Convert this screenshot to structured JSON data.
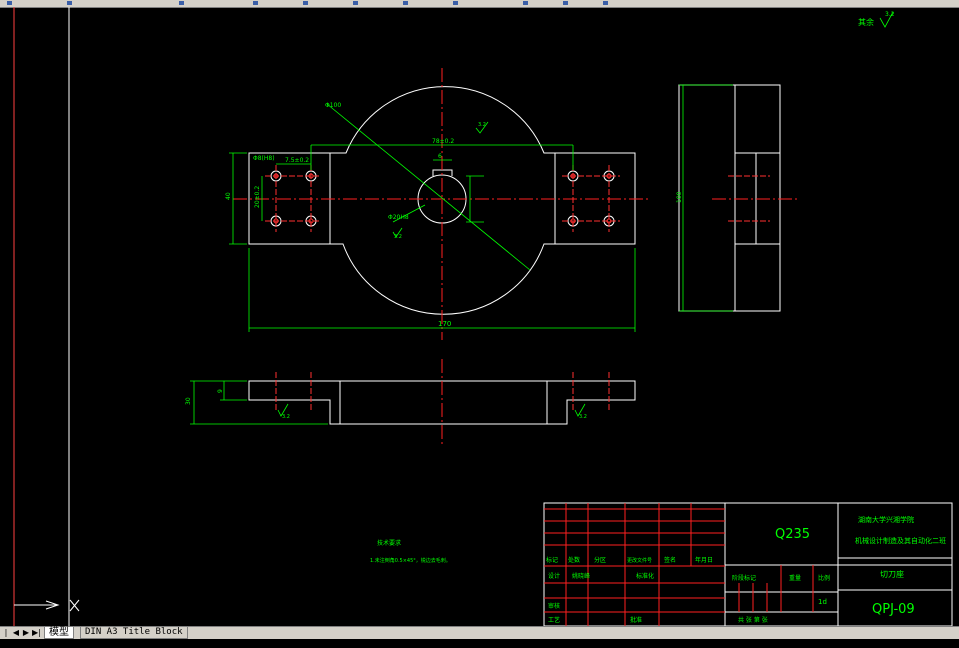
{
  "tabs": [
    {
      "label": "模型"
    },
    {
      "label": "DIN A3 Title Block"
    }
  ],
  "drawing": {
    "top_right_label": "其余",
    "top_right_roughness": "3.2",
    "dims_plan": {
      "phi100": "Φ100",
      "hole_dia": "Φ8(H8)",
      "width_130": "130",
      "length_170": "170",
      "width_40": "40",
      "spacing_20": "20±0.2",
      "edge_7_5": "7.5±0.2",
      "pitch_78": "78±0.2",
      "bore_phi20": "Φ20H8",
      "keyway_6": "6",
      "rough_a": "3.2",
      "rough_b": "3.2"
    },
    "dims_side": {
      "height_30": "30",
      "depth_9": "9",
      "rough": "3.2",
      "rough2": "3.2"
    },
    "dims_right": {
      "height_100": "100"
    },
    "notes_title": "技术要求",
    "notes_line": "1.未注倒角0.5×45°，锐边去毛刺。"
  },
  "title_block": {
    "material": "Q235",
    "school": "湖南大学兴湘学院",
    "project": "机械设计制造及其自动化二班",
    "part_name": "切刀座",
    "drawing_no": "QPJ-09",
    "scale_label": "比例",
    "scale_value": "1:1",
    "weight_label": "重量",
    "stage_label": "阶段标记",
    "qty_value": "1d",
    "sheet_label": "共 张 第 张",
    "row_labels": [
      "标记",
      "处数",
      "分区",
      "更改文件号",
      "签名",
      "年月日"
    ],
    "design_label": "设计",
    "designer": "姚晓峰",
    "std_label": "标准化",
    "check_label": "审核",
    "process_label": "工艺",
    "approve_label": "批准"
  }
}
